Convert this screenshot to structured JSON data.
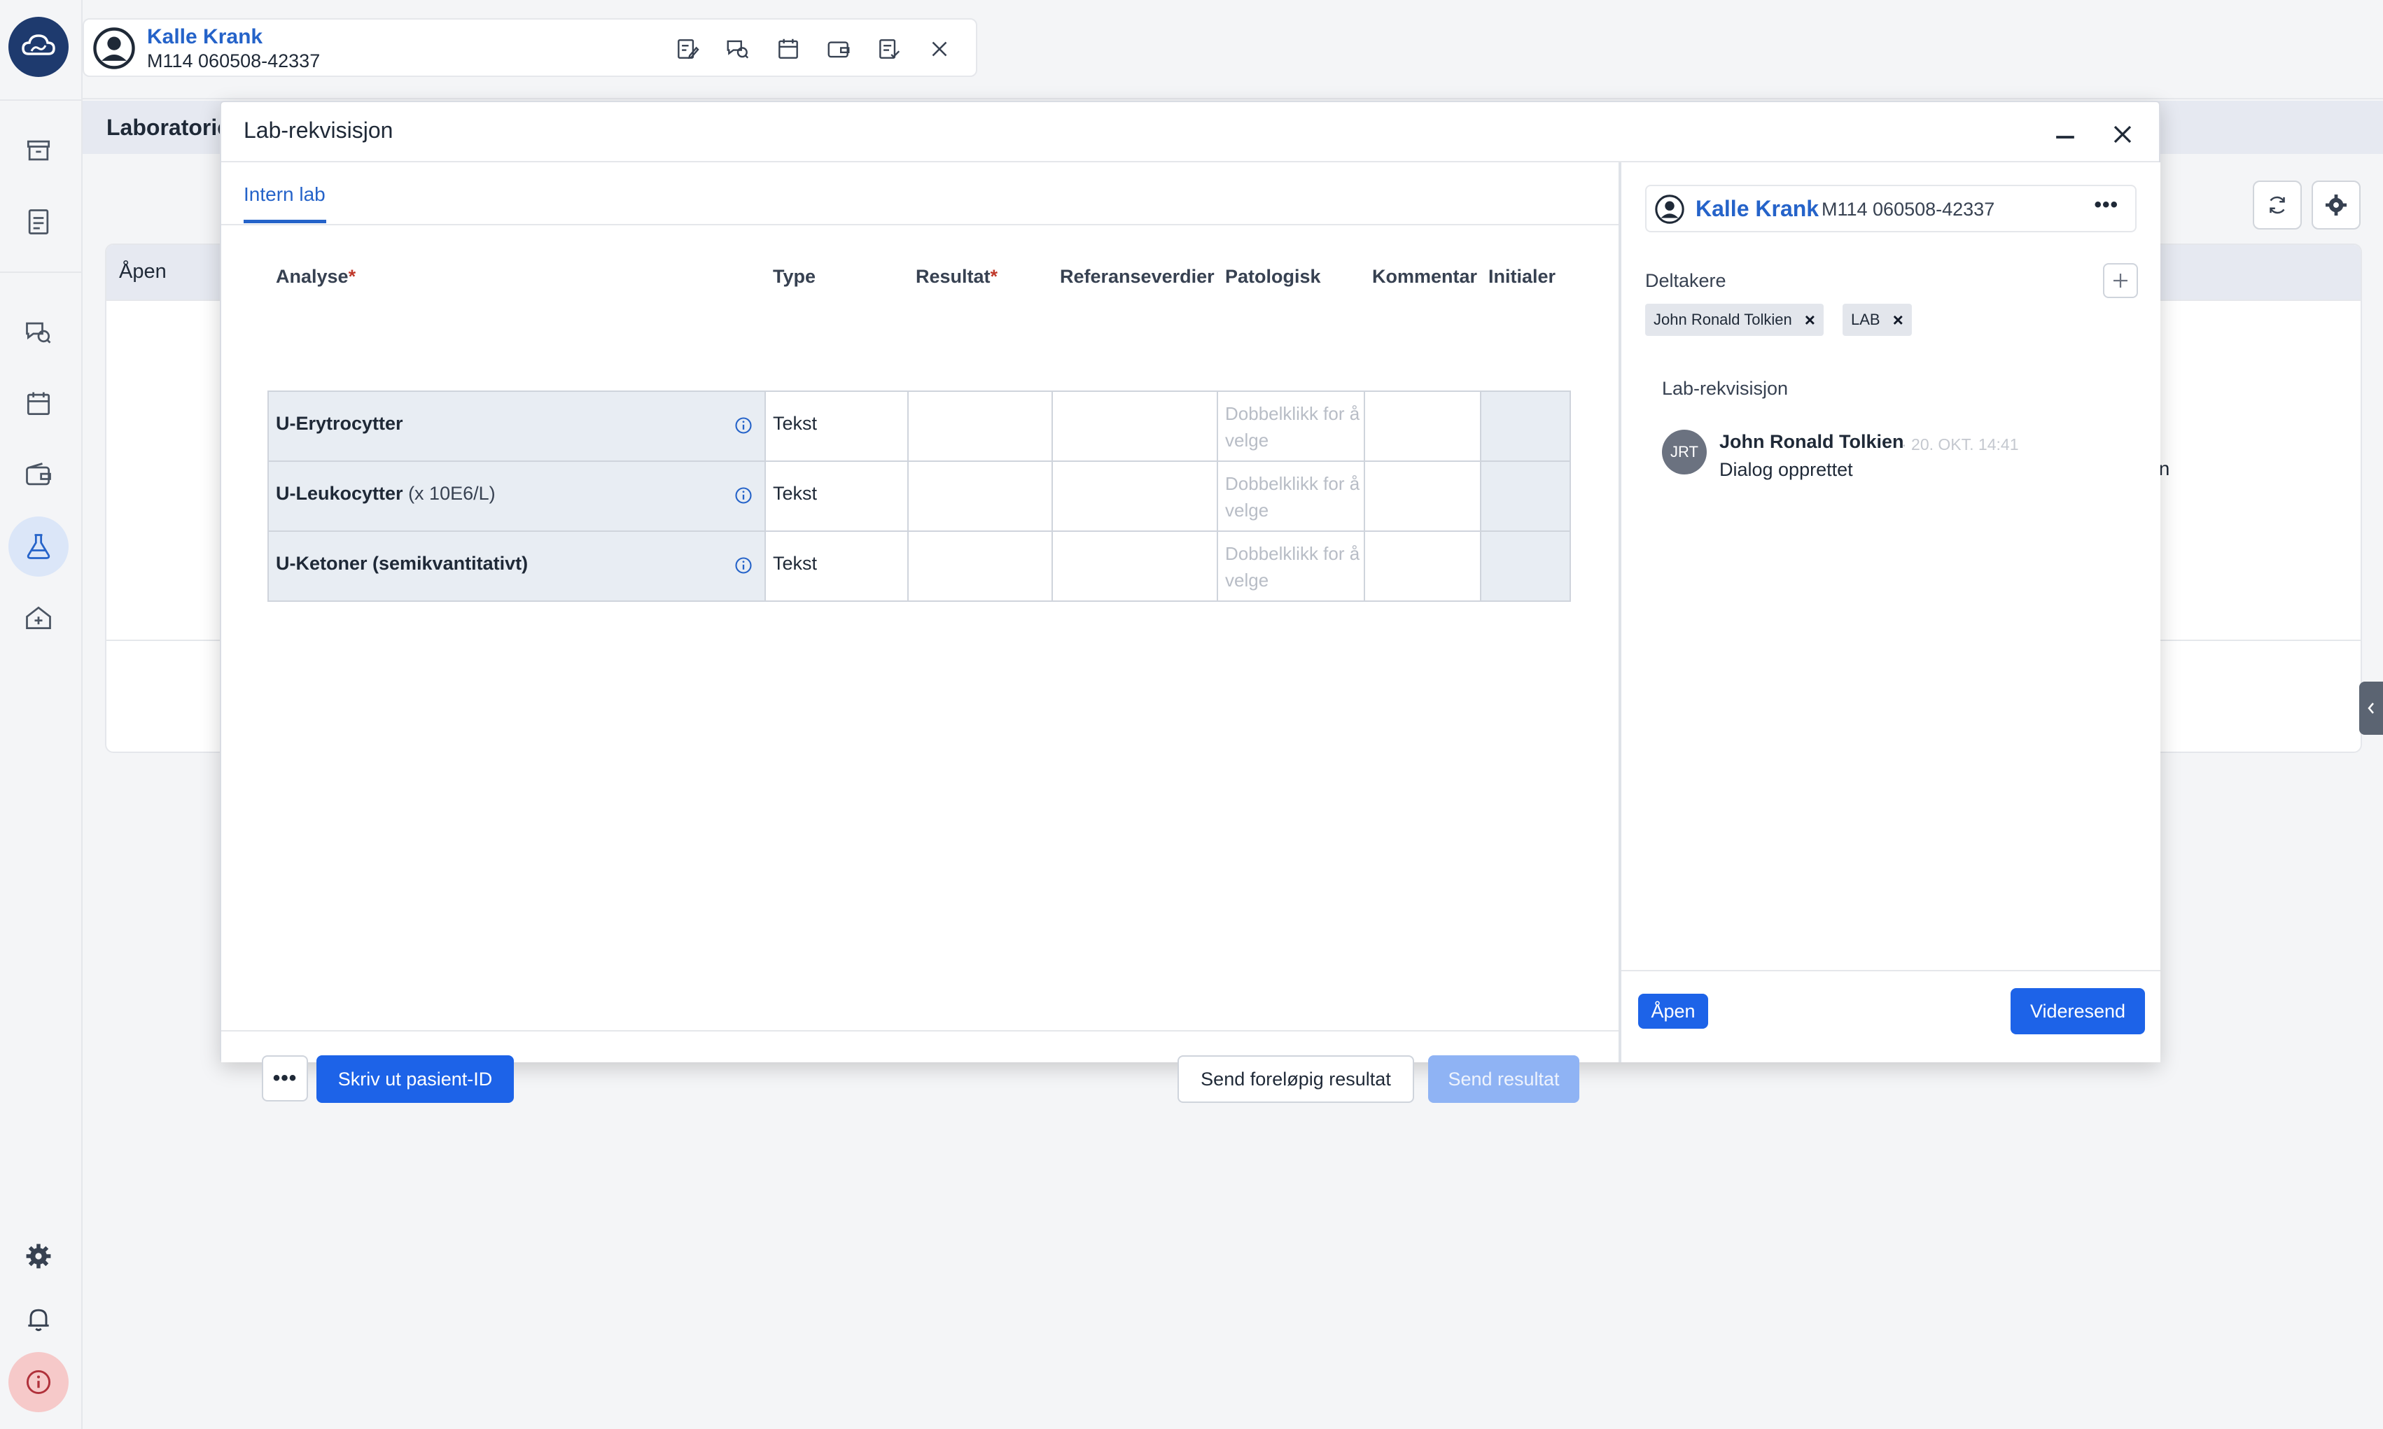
{
  "app": {
    "patient_name": "Kalle Krank",
    "patient_id": "M114 060508-42337"
  },
  "topbar_icons": [
    "note-edit-icon",
    "chat-search-icon",
    "calendar-icon",
    "wallet-icon",
    "checklist-icon",
    "close-icon"
  ],
  "rail_icons": [
    "archive-icon",
    "document-icon",
    "chat-icon",
    "calendar-icon",
    "wallet-icon",
    "lab-flask-icon",
    "home-care-icon",
    "settings-gear-icon",
    "bell-icon",
    "info-icon"
  ],
  "background": {
    "page_title": "Laboratorie",
    "column_header": "Åpen",
    "partial_text": "ien"
  },
  "modal": {
    "title": "Lab-rekvisisjon",
    "tab": "Intern lab",
    "columns": {
      "analyse": "Analyse",
      "type": "Type",
      "resultat": "Resultat",
      "referanse": "Referanseverdier",
      "patologisk": "Patologisk",
      "kommentar": "Kommentar",
      "initialer": "Initialer",
      "required_mark": "*"
    },
    "rows": [
      {
        "name": "U-Erytrocytter",
        "unit": "",
        "type": "Tekst",
        "patologisk": "Dobbelklikk for å velge"
      },
      {
        "name": "U-Leukocytter",
        "unit": "(x 10E6/L)",
        "type": "Tekst",
        "patologisk": "Dobbelklikk for å velge"
      },
      {
        "name": "U-Ketoner (semikvantitativt)",
        "unit": "",
        "type": "Tekst",
        "patologisk": "Dobbelklikk for å velge"
      }
    ],
    "footer": {
      "more": "•••",
      "print_id": "Skriv ut pasient-ID",
      "send_preliminary": "Send foreløpig resultat",
      "send_result": "Send resultat"
    }
  },
  "dialog": {
    "patient_name": "Kalle Krank",
    "patient_id": "M114 060508-42337",
    "more": "•••",
    "participants_label": "Deltakere",
    "participants": [
      "John Ronald Tolkien",
      "LAB"
    ],
    "chip_remove": "×",
    "section_title": "Lab-rekvisisjon",
    "message": {
      "initials": "JRT",
      "author": "John Ronald Tolkien",
      "time": "· 20. OKT. 14:41",
      "text": "Dialog opprettet"
    },
    "status_button": "Åpen",
    "forward_button": "Videresend"
  },
  "colors": {
    "accent": "#1d63e8",
    "link": "#2563c9",
    "logo": "#1e3a6e"
  }
}
